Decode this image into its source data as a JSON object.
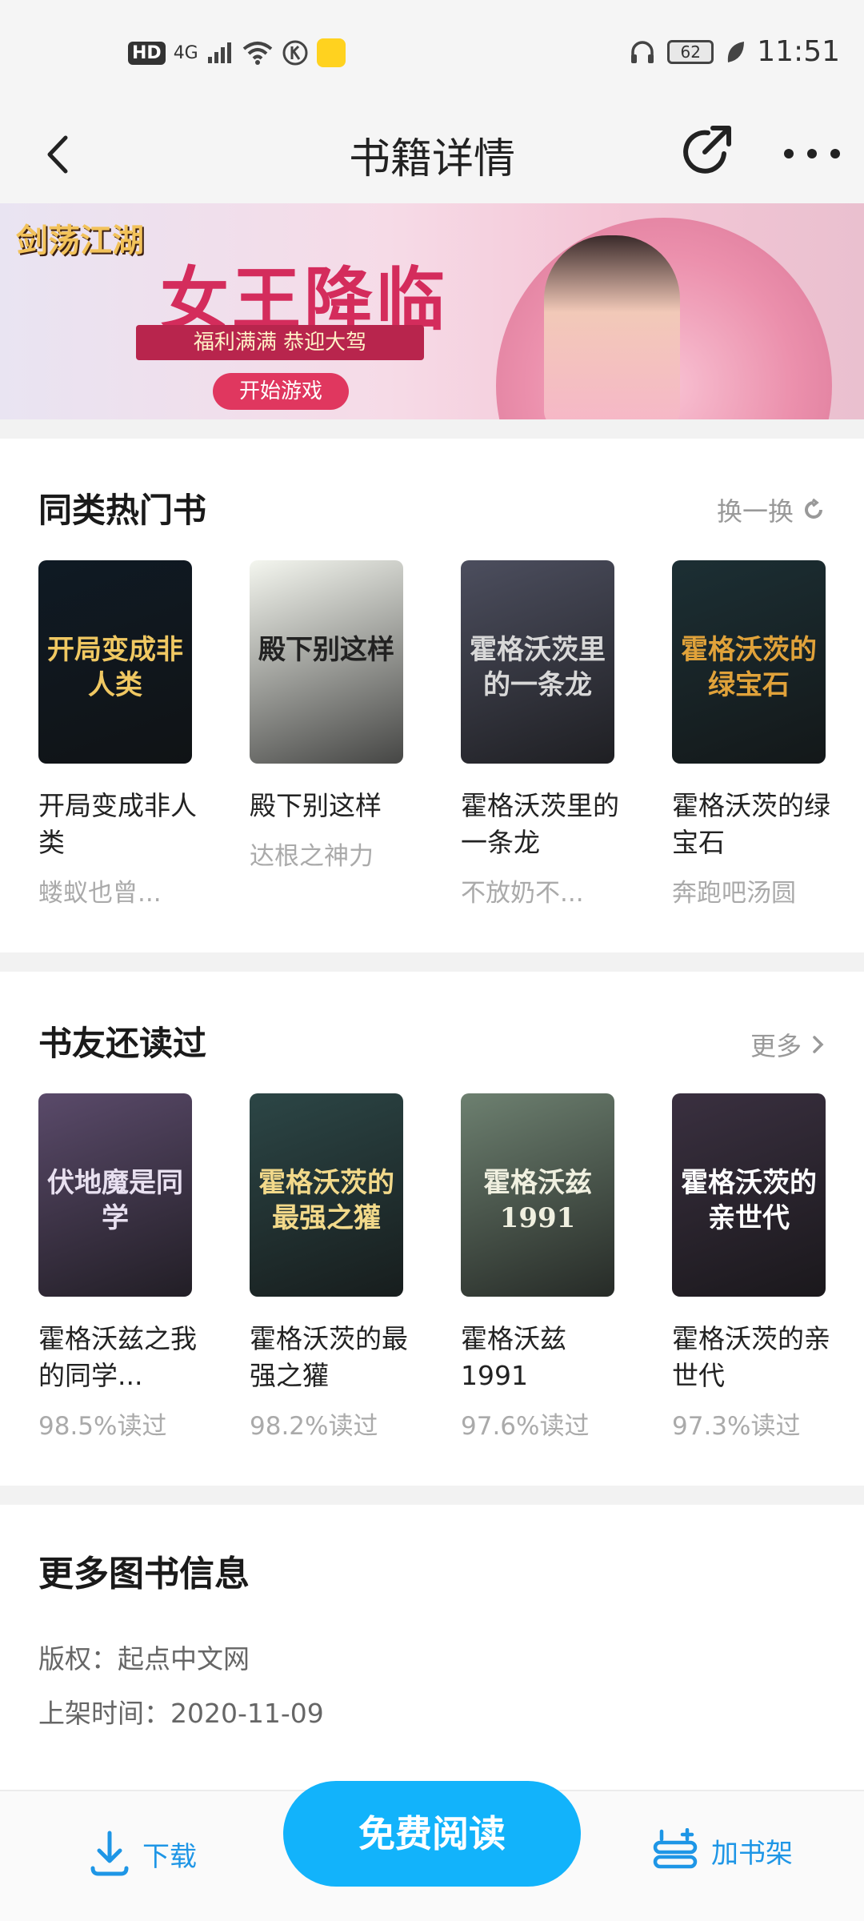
{
  "status_bar": {
    "hd": "HD",
    "network": "4G",
    "battery": "62",
    "time": "11:51"
  },
  "header": {
    "title": "书籍详情"
  },
  "banner": {
    "game_logo": "剑荡江湖",
    "headline": "女王降临",
    "subline": "福利满满 恭迎大驾",
    "cta": "开始游戏"
  },
  "similar_books": {
    "title": "同类热门书",
    "refresh_label": "换一换",
    "items": [
      {
        "name": "开局变成非人类",
        "author": "蝼蚁也曾...",
        "cover_text": "开局变成非人类",
        "cover_bg": "#0f1a24",
        "cover_fg": "#f0c862"
      },
      {
        "name": "殿下别这样",
        "author": "达根之神力",
        "cover_text": "殿下别这样",
        "cover_bg": "#f4f6ef",
        "cover_fg": "#222222"
      },
      {
        "name": "霍格沃茨里的一条龙",
        "author": "不放奶不...",
        "cover_text": "霍格沃茨里的一条龙",
        "cover_bg": "#4c4e5e",
        "cover_fg": "#d8d8d8"
      },
      {
        "name": "霍格沃茨的绿宝石",
        "author": "奔跑吧汤圆",
        "cover_text": "霍格沃茨的绿宝石",
        "cover_bg": "#1c2f34",
        "cover_fg": "#e0a23a"
      }
    ]
  },
  "readers_also": {
    "title": "书友还读过",
    "more_label": "更多",
    "items": [
      {
        "name": "霍格沃兹之我的同学...",
        "percent": "98.5%读过",
        "cover_text": "伏地魔是同学",
        "cover_bg": "#5a4a6a",
        "cover_fg": "#e8e0f0"
      },
      {
        "name": "霍格沃茨的最强之獾",
        "percent": "98.2%读过",
        "cover_text": "霍格沃茨的最强之獾",
        "cover_bg": "#2c4646",
        "cover_fg": "#f2d98a"
      },
      {
        "name": "霍格沃兹1991",
        "percent": "97.6%读过",
        "cover_text": "霍格沃兹 1991",
        "cover_bg": "#6d8070",
        "cover_fg": "#f0f0e0"
      },
      {
        "name": "霍格沃茨的亲世代",
        "percent": "97.3%读过",
        "cover_text": "霍格沃茨的亲世代",
        "cover_bg": "#3a3040",
        "cover_fg": "#ffffff"
      }
    ]
  },
  "more_info": {
    "title": "更多图书信息",
    "copyright": "版权：起点中文网",
    "shelf_date": "上架时间：2020-11-09"
  },
  "bottom_bar": {
    "download": "下载",
    "read_free": "免费阅读",
    "add_shelf": "加书架"
  },
  "colors": {
    "accent": "#12b3fb",
    "link_blue": "#1e96e6"
  }
}
